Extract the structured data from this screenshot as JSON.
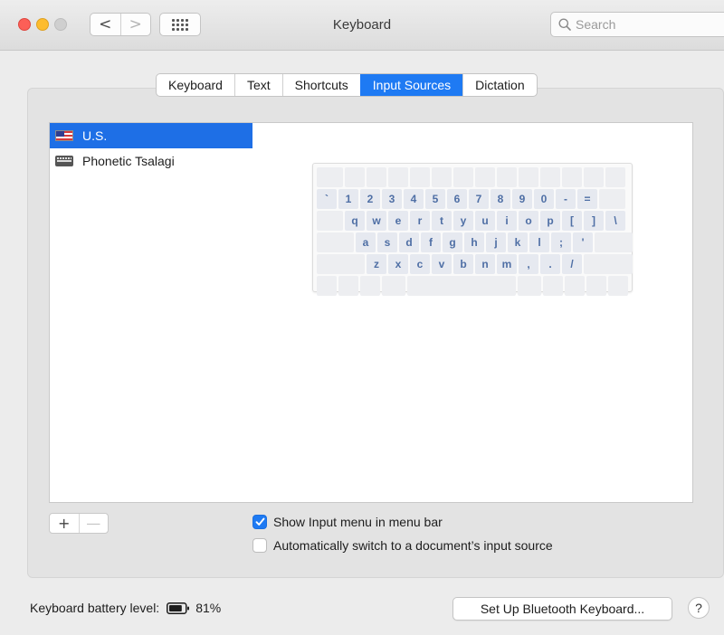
{
  "window": {
    "title": "Keyboard",
    "search_placeholder": "Search"
  },
  "tabs": [
    {
      "label": "Keyboard",
      "active": false
    },
    {
      "label": "Text",
      "active": false
    },
    {
      "label": "Shortcuts",
      "active": false
    },
    {
      "label": "Input Sources",
      "active": true
    },
    {
      "label": "Dictation",
      "active": false
    }
  ],
  "input_sources": [
    {
      "label": "U.S.",
      "icon": "us-flag-icon",
      "selected": true
    },
    {
      "label": "Phonetic Tsalagi",
      "icon": "keyboard-icon",
      "selected": false
    }
  ],
  "keyboard_rows": [
    [
      "`",
      "1",
      "2",
      "3",
      "4",
      "5",
      "6",
      "7",
      "8",
      "9",
      "0",
      "-",
      "="
    ],
    [
      "q",
      "w",
      "e",
      "r",
      "t",
      "y",
      "u",
      "i",
      "o",
      "p",
      "[",
      "]",
      "\\"
    ],
    [
      "a",
      "s",
      "d",
      "f",
      "g",
      "h",
      "j",
      "k",
      "l",
      ";",
      "'"
    ],
    [
      "z",
      "x",
      "c",
      "v",
      "b",
      "n",
      "m",
      ",",
      ".",
      "/"
    ]
  ],
  "buttons": {
    "add": "+",
    "remove": "—",
    "back": "<",
    "forward": ">",
    "setup_bluetooth": "Set Up Bluetooth Keyboard...",
    "help": "?"
  },
  "options": {
    "show_input_menu": {
      "label": "Show Input menu in menu bar",
      "checked": true
    },
    "auto_switch": {
      "label": "Automatically switch to a document’s input source",
      "checked": false
    }
  },
  "battery": {
    "label": "Keyboard battery level:",
    "percent": "81%",
    "level": 0.81
  },
  "colors": {
    "accent": "#1e7af3",
    "selection": "#1e6fe6",
    "key_text": "#4f6fa5"
  }
}
